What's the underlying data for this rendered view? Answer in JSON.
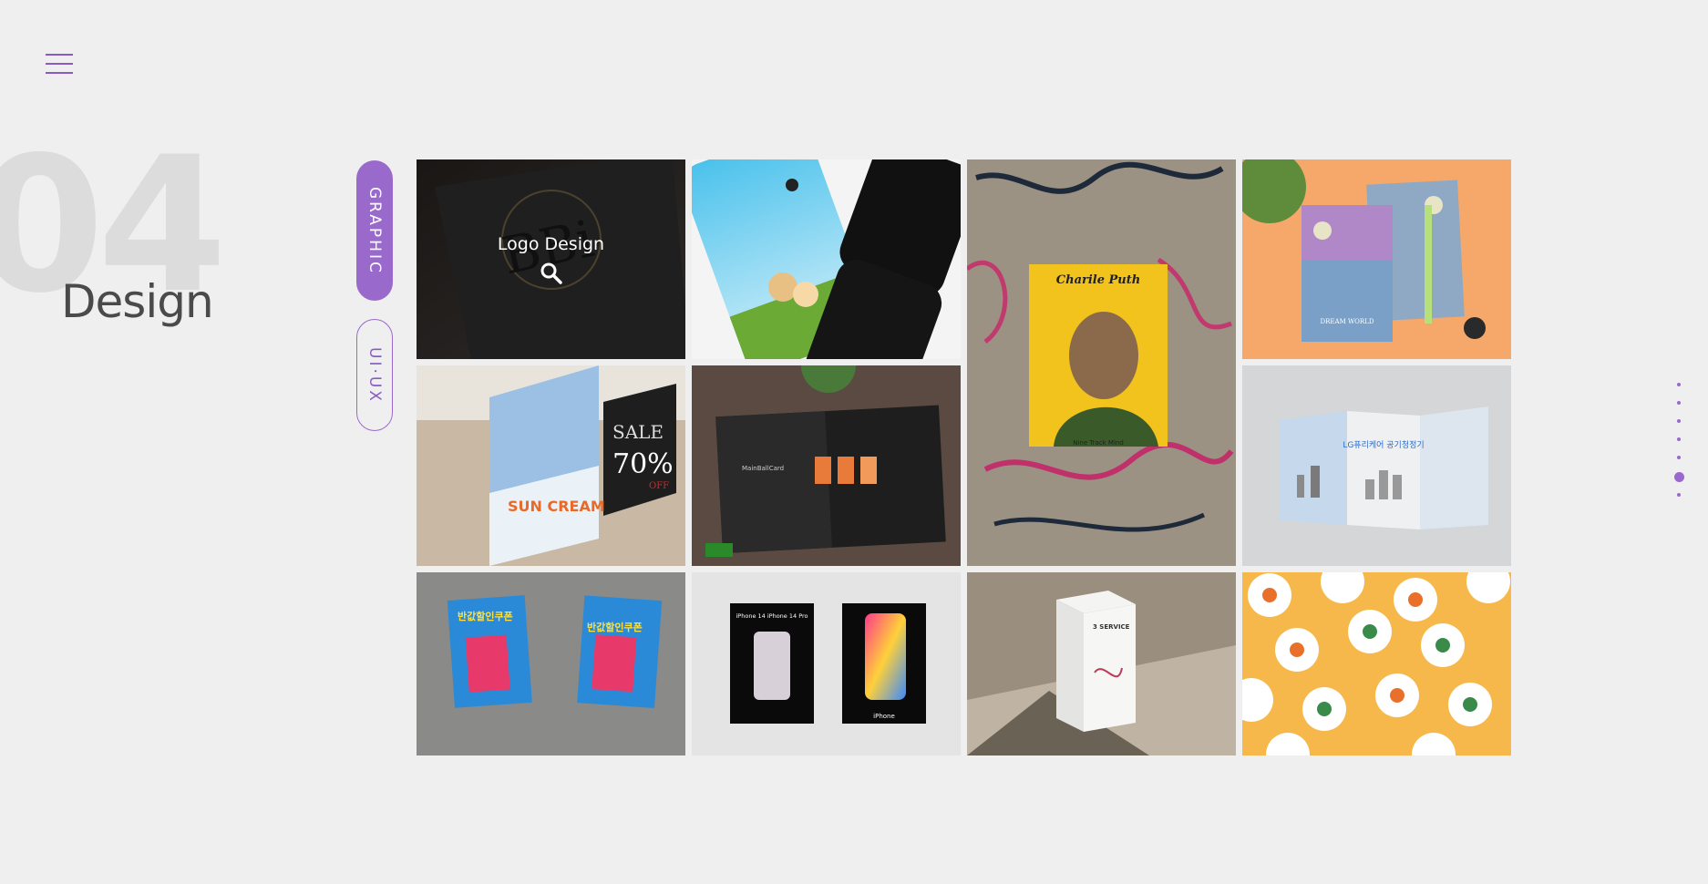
{
  "menu": {
    "icon": "hamburger-menu-icon"
  },
  "section": {
    "number": "04",
    "title": "Design"
  },
  "categories": [
    {
      "label": "GRAPHIC",
      "active": true
    },
    {
      "label": "UI·UX",
      "active": false
    }
  ],
  "portfolio": {
    "hover_label": "Logo Design",
    "logo_mark": "BBi",
    "poster_title": "Charile Puth",
    "poster_caption": "Nine Track Mind",
    "sale_text": "SALE",
    "sale_percent": "70%",
    "sale_off": "OFF",
    "sun_cream": "SUN CREAM",
    "brand_card": "MainBallCard",
    "lg_title": "LG퓨리케어 공기청정기",
    "coupon_title": "반값할인쿠폰",
    "coupon_big": "반값",
    "iphone_title": "iPhone 14 iPhone 14 Pro",
    "iphone_sub": "iPhone",
    "box_text": "3 SERVICE",
    "dreamworld": "DREAM WORLD"
  },
  "page_dots": {
    "count": 7,
    "active_index": 5
  },
  "colors": {
    "accent": "#9a69cc",
    "background": "#efefef"
  }
}
